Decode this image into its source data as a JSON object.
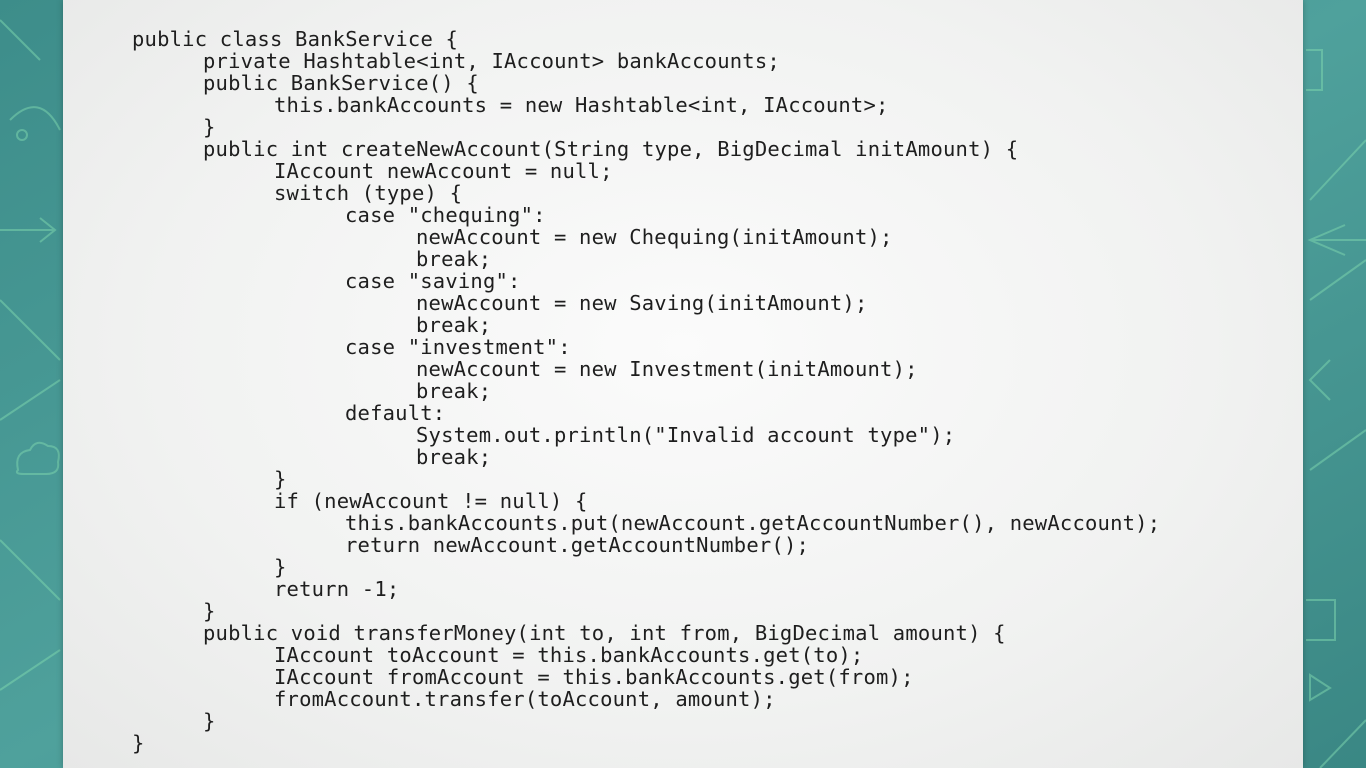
{
  "slide": {
    "lines": [
      {
        "indent": 0,
        "text": "public class BankService {"
      },
      {
        "indent": 1,
        "text": "private Hashtable<int, IAccount> bankAccounts;"
      },
      {
        "indent": 1,
        "text": "public BankService() {"
      },
      {
        "indent": 2,
        "text": "this.bankAccounts = new Hashtable<int, IAccount>;"
      },
      {
        "indent": 1,
        "text": "}"
      },
      {
        "indent": 1,
        "text": "public int createNewAccount(String type, BigDecimal initAmount) {"
      },
      {
        "indent": 2,
        "text": "IAccount newAccount = null;"
      },
      {
        "indent": 2,
        "text": "switch (type) {"
      },
      {
        "indent": 3,
        "text": "case \"chequing\":"
      },
      {
        "indent": 4,
        "text": "newAccount = new Chequing(initAmount);"
      },
      {
        "indent": 4,
        "text": "break;"
      },
      {
        "indent": 3,
        "text": "case \"saving\":"
      },
      {
        "indent": 4,
        "text": "newAccount = new Saving(initAmount);"
      },
      {
        "indent": 4,
        "text": "break;"
      },
      {
        "indent": 3,
        "text": "case \"investment\":"
      },
      {
        "indent": 4,
        "text": "newAccount = new Investment(initAmount);"
      },
      {
        "indent": 4,
        "text": "break;"
      },
      {
        "indent": 3,
        "text": "default:"
      },
      {
        "indent": 4,
        "text": "System.out.println(\"Invalid account type\");"
      },
      {
        "indent": 4,
        "text": "break;"
      },
      {
        "indent": 2,
        "text": "}"
      },
      {
        "indent": 2,
        "text": "if (newAccount != null) {"
      },
      {
        "indent": 3,
        "text": "this.bankAccounts.put(newAccount.getAccountNumber(), newAccount);"
      },
      {
        "indent": 3,
        "text": "return newAccount.getAccountNumber();"
      },
      {
        "indent": 2,
        "text": "}"
      },
      {
        "indent": 2,
        "text": "return -1;"
      },
      {
        "indent": 1,
        "text": "}"
      },
      {
        "indent": 1,
        "text": "public void transferMoney(int to, int from, BigDecimal amount) {"
      },
      {
        "indent": 2,
        "text": "IAccount toAccount = this.bankAccounts.get(to);"
      },
      {
        "indent": 2,
        "text": "IAccount fromAccount = this.bankAccounts.get(from);"
      },
      {
        "indent": 2,
        "text": "fromAccount.transfer(toAccount, amount);"
      },
      {
        "indent": 1,
        "text": "}"
      },
      {
        "indent": 0,
        "text": "}"
      }
    ]
  },
  "colors": {
    "background": "#4a9a96",
    "slide": "#f3f4f3",
    "code_text": "#1e1e1e",
    "decor_line": "#6fc7a3"
  },
  "decor_icons": [
    "leaf-icon",
    "arrow-icon",
    "cloud-icon",
    "document-icon",
    "arrow-left-icon",
    "play-icon"
  ]
}
